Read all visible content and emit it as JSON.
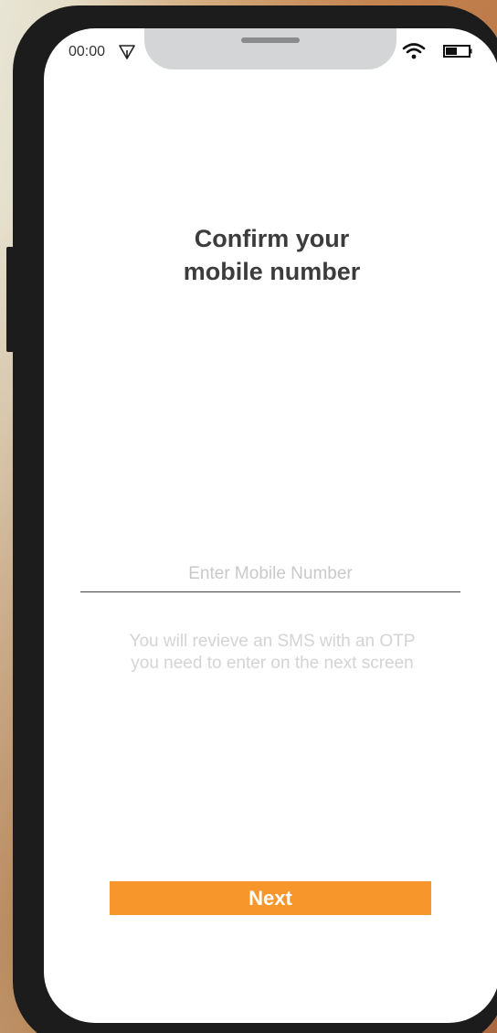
{
  "status_bar": {
    "time": "00:00",
    "icons": [
      "navigation-arrow-icon",
      "wifi-icon",
      "battery-icon"
    ]
  },
  "title": "Confirm your\nmobile number",
  "mobile_input": {
    "value": "",
    "placeholder": "Enter Mobile Number"
  },
  "info_text": "You will revieve an SMS with an OTP you need to enter on the next screen",
  "next_button": {
    "label": "Next"
  },
  "colors": {
    "accent": "#f7962a",
    "title_text": "#3c3c3c",
    "muted_text": "#d4d4d4",
    "device_frame": "#1c1c1c"
  }
}
